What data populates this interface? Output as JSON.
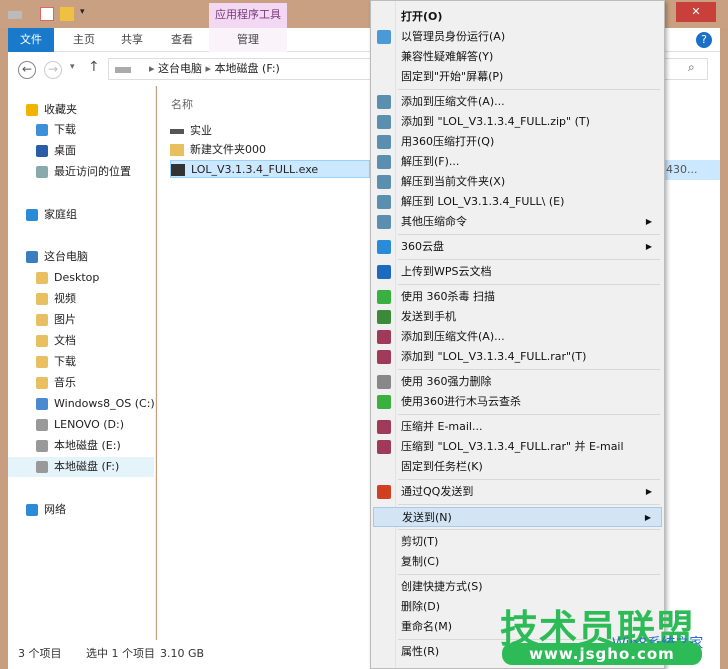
{
  "ribbon": {
    "context_tab": "应用程序工具",
    "tabs": [
      "文件",
      "主页",
      "共享",
      "查看",
      "管理"
    ]
  },
  "address": {
    "path": [
      "这台电脑",
      "本地磁盘 (F:)"
    ]
  },
  "nav": [
    {
      "label": "收藏夹",
      "icon": "star-icon",
      "color": "#f0b400",
      "indent": 0
    },
    {
      "label": "下载",
      "icon": "downloads-folder-icon",
      "color": "#3d8fd8",
      "indent": 1
    },
    {
      "label": "桌面",
      "icon": "desktop-icon",
      "color": "#2a5ca8",
      "indent": 1
    },
    {
      "label": "最近访问的位置",
      "icon": "recent-places-icon",
      "color": "#8aa",
      "indent": 1
    },
    {
      "label": "家庭组",
      "icon": "homegroup-icon",
      "color": "#2a8bd8",
      "indent": 0
    },
    {
      "label": "这台电脑",
      "icon": "computer-icon",
      "color": "#3a7ec0",
      "indent": 0
    },
    {
      "label": "Desktop",
      "icon": "folder-icon",
      "color": "#e8c060",
      "indent": 1
    },
    {
      "label": "视频",
      "icon": "videos-folder-icon",
      "color": "#e8c060",
      "indent": 1
    },
    {
      "label": "图片",
      "icon": "pictures-folder-icon",
      "color": "#e8c060",
      "indent": 1
    },
    {
      "label": "文档",
      "icon": "documents-folder-icon",
      "color": "#e8c060",
      "indent": 1
    },
    {
      "label": "下载",
      "icon": "downloads-folder-icon",
      "color": "#e8c060",
      "indent": 1
    },
    {
      "label": "音乐",
      "icon": "music-folder-icon",
      "color": "#e8c060",
      "indent": 1
    },
    {
      "label": "Windows8_OS (C:)",
      "icon": "drive-icon",
      "color": "#4a8ad0",
      "indent": 1
    },
    {
      "label": "LENOVO (D:)",
      "icon": "drive-icon",
      "color": "#999",
      "indent": 1
    },
    {
      "label": "本地磁盘 (E:)",
      "icon": "drive-icon",
      "color": "#999",
      "indent": 1
    },
    {
      "label": "本地磁盘 (F:)",
      "icon": "drive-icon",
      "color": "#999",
      "indent": 1,
      "selected": true
    },
    {
      "label": "网络",
      "icon": "network-icon",
      "color": "#2a8bd8",
      "indent": 0
    }
  ],
  "content": {
    "column_name": "名称",
    "files": [
      {
        "name": "实业",
        "icon": "drive-icon"
      },
      {
        "name": "新建文件夹000",
        "icon": "folder-icon"
      },
      {
        "name": "LOL_V3.1.3.4_FULL.exe",
        "icon": "exe-icon",
        "selected": true
      }
    ],
    "truncated_size": "430..."
  },
  "status": {
    "items": "3 个项目",
    "selected": "选中 1 个项目",
    "size": "3.10 GB"
  },
  "menu": [
    {
      "label": "打开(O)",
      "bold": true
    },
    {
      "label": "以管理员身份运行(A)",
      "icon": "uac-shield-icon",
      "color": "#4a9ad8"
    },
    {
      "label": "兼容性疑难解答(Y)"
    },
    {
      "label": "固定到\"开始\"屏幕(P)"
    },
    {
      "sep": true
    },
    {
      "label": "添加到压缩文件(A)...",
      "icon": "archive-icon",
      "color": "#5b8fb0"
    },
    {
      "label": "添加到 \"LOL_V3.1.3.4_FULL.zip\" (T)",
      "icon": "archive-icon",
      "color": "#5b8fb0"
    },
    {
      "label": "用360压缩打开(Q)",
      "icon": "archive-icon",
      "color": "#5b8fb0"
    },
    {
      "label": "解压到(F)...",
      "icon": "archive-icon",
      "color": "#5b8fb0"
    },
    {
      "label": "解压到当前文件夹(X)",
      "icon": "archive-icon",
      "color": "#5b8fb0"
    },
    {
      "label": "解压到 LOL_V3.1.3.4_FULL\\ (E)",
      "icon": "archive-icon",
      "color": "#5b8fb0"
    },
    {
      "label": "其他压缩命令",
      "icon": "archive-icon",
      "color": "#5b8fb0",
      "submenu": true
    },
    {
      "sep": true
    },
    {
      "label": "360云盘",
      "icon": "cloud-icon",
      "color": "#2a8bd8",
      "submenu": true
    },
    {
      "sep": true
    },
    {
      "label": "上传到WPS云文档",
      "icon": "wps-icon",
      "color": "#1a6ac0"
    },
    {
      "sep": true
    },
    {
      "label": "使用 360杀毒 扫描",
      "icon": "antivirus-icon",
      "color": "#3ab040"
    },
    {
      "label": "发送到手机",
      "icon": "phone-icon",
      "color": "#3a8a3a"
    },
    {
      "label": "添加到压缩文件(A)...",
      "icon": "winrar-icon",
      "color": "#a03a5a"
    },
    {
      "label": "添加到 \"LOL_V3.1.3.4_FULL.rar\"(T)",
      "icon": "winrar-icon",
      "color": "#a03a5a"
    },
    {
      "sep": true
    },
    {
      "label": "使用 360强力删除",
      "icon": "shredder-icon",
      "color": "#888"
    },
    {
      "label": "使用360进行木马云查杀",
      "icon": "trojan-scan-icon",
      "color": "#3ab040"
    },
    {
      "sep": true
    },
    {
      "label": "压缩并 E-mail...",
      "icon": "winrar-icon",
      "color": "#a03a5a"
    },
    {
      "label": "压缩到 \"LOL_V3.1.3.4_FULL.rar\" 并 E-mail",
      "icon": "winrar-icon",
      "color": "#a03a5a"
    },
    {
      "label": "固定到任务栏(K)"
    },
    {
      "sep": true
    },
    {
      "label": "通过QQ发送到",
      "icon": "qq-icon",
      "color": "#d04020",
      "submenu": true
    },
    {
      "sep": true
    },
    {
      "label": "发送到(N)",
      "submenu": true,
      "highlighted": true
    },
    {
      "sep": true
    },
    {
      "label": "剪切(T)"
    },
    {
      "label": "复制(C)"
    },
    {
      "sep": true
    },
    {
      "label": "创建快捷方式(S)"
    },
    {
      "label": "删除(D)"
    },
    {
      "label": "重命名(M)"
    },
    {
      "sep": true
    },
    {
      "label": "属性(R)"
    }
  ],
  "watermark": {
    "title": "技术员联盟",
    "url": "www.jsgho.com",
    "sub": "Win8系统之家"
  }
}
